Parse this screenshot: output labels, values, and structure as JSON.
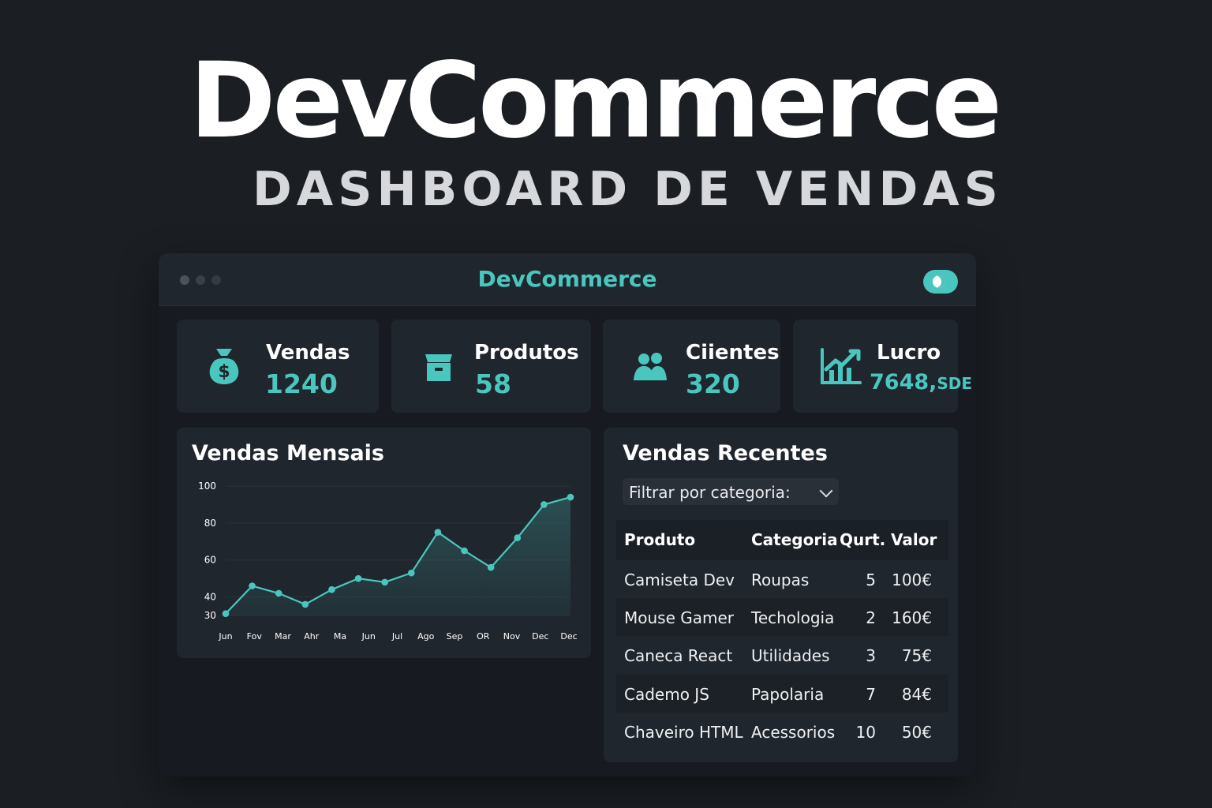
{
  "hero": {
    "title": "DevCommerce",
    "subtitle": "DASHBOARD DE VENDAS"
  },
  "window": {
    "title": "DevCommerce"
  },
  "stats": [
    {
      "label": "Vendas",
      "value": "1240",
      "icon": "money-bag-icon"
    },
    {
      "label": "Produtos",
      "value": "58",
      "icon": "box-icon"
    },
    {
      "label": "Ciientes",
      "value": "320",
      "icon": "users-icon"
    },
    {
      "label": "Lucro",
      "value": "7648,",
      "unit": "SDE",
      "icon": "growth-chart-icon"
    }
  ],
  "chart_panel": {
    "title": "Vendas Mensais"
  },
  "chart_data": {
    "type": "area",
    "title": "Vendas Mensais",
    "xlabel": "",
    "ylabel": "",
    "y_ticks": [
      100,
      80,
      60,
      40,
      30
    ],
    "ylim": [
      30,
      100
    ],
    "x_tick_labels": [
      "Jun",
      "Fov",
      "Mar",
      "Ahr",
      "Ma",
      "Jun",
      "Jul",
      "Ago",
      "Sep",
      "OR",
      "Nov",
      "Dec",
      "Dec"
    ],
    "series": [
      {
        "values": [
          31,
          46,
          42,
          36,
          44,
          50,
          48,
          53,
          75,
          65,
          56,
          72,
          90,
          94
        ]
      }
    ],
    "grid": true,
    "legend": "none",
    "accent_color": "#49c7bf"
  },
  "sales_panel": {
    "title": "Vendas Recentes",
    "filter_label": "Filtrar por categoria:",
    "columns": [
      "Produto",
      "Categoria",
      "Qurt.",
      "Valor"
    ],
    "rows": [
      [
        "Camiseta Dev",
        "Roupas",
        "5",
        "100€"
      ],
      [
        "Mouse Gamer",
        "Techologia",
        "2",
        "160€"
      ],
      [
        "Caneca React",
        "Utilidades",
        "3",
        "75€"
      ],
      [
        "Cademo JS",
        "Papolaria",
        "7",
        "84€"
      ],
      [
        "Chaveiro HTML",
        "Acessorios",
        "10",
        "50€"
      ]
    ]
  },
  "colors": {
    "background": "#1b1f24",
    "panel": "#20262e",
    "accent": "#49c7bf",
    "text": "#ffffff"
  }
}
